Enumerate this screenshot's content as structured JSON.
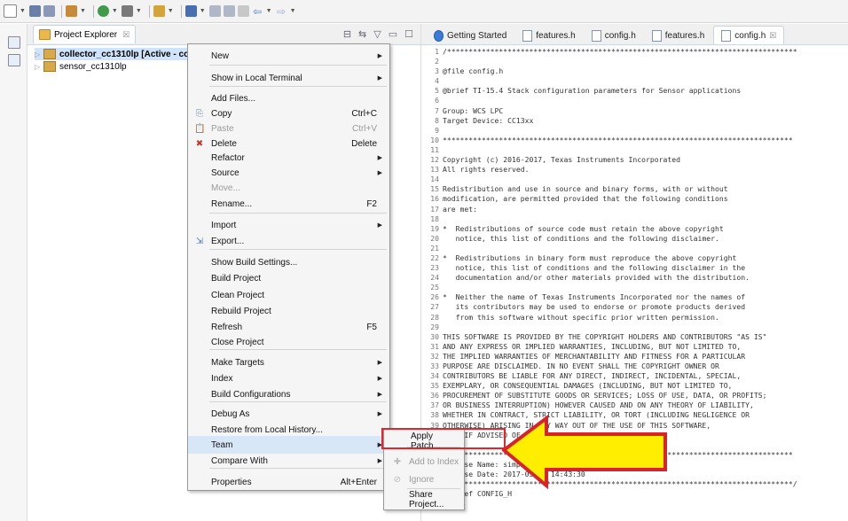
{
  "project_explorer": {
    "title": "Project Explorer",
    "tab_close": "☒",
    "projects": [
      {
        "name": "collector_cc1310lp [Active - col",
        "selected": true
      },
      {
        "name": "sensor_cc1310lp",
        "selected": false
      }
    ]
  },
  "context_menu": {
    "items": [
      {
        "label": "New",
        "shortcut": "",
        "submenu": true,
        "disabled": false
      },
      {
        "label": "Show in Local Terminal",
        "shortcut": "",
        "submenu": true,
        "disabled": false
      },
      {
        "label": "Add Files...",
        "shortcut": "",
        "submenu": false,
        "disabled": false
      },
      {
        "label": "Copy",
        "shortcut": "Ctrl+C",
        "submenu": false,
        "disabled": false
      },
      {
        "label": "Paste",
        "shortcut": "Ctrl+V",
        "submenu": false,
        "disabled": true
      },
      {
        "label": "Delete",
        "shortcut": "Delete",
        "submenu": false,
        "disabled": false
      },
      {
        "label": "Refactor",
        "shortcut": "",
        "submenu": true,
        "disabled": false
      },
      {
        "label": "Source",
        "shortcut": "",
        "submenu": true,
        "disabled": false
      },
      {
        "label": "Move...",
        "shortcut": "",
        "submenu": false,
        "disabled": true
      },
      {
        "label": "Rename...",
        "shortcut": "F2",
        "submenu": false,
        "disabled": false
      },
      {
        "label": "Import",
        "shortcut": "",
        "submenu": true,
        "disabled": false
      },
      {
        "label": "Export...",
        "shortcut": "",
        "submenu": false,
        "disabled": false
      },
      {
        "label": "Show Build Settings...",
        "shortcut": "",
        "submenu": false,
        "disabled": false
      },
      {
        "label": "Build Project",
        "shortcut": "",
        "submenu": false,
        "disabled": false
      },
      {
        "label": "Clean Project",
        "shortcut": "",
        "submenu": false,
        "disabled": false
      },
      {
        "label": "Rebuild Project",
        "shortcut": "",
        "submenu": false,
        "disabled": false
      },
      {
        "label": "Refresh",
        "shortcut": "F5",
        "submenu": false,
        "disabled": false
      },
      {
        "label": "Close Project",
        "shortcut": "",
        "submenu": false,
        "disabled": false
      },
      {
        "label": "Make Targets",
        "shortcut": "",
        "submenu": true,
        "disabled": false
      },
      {
        "label": "Index",
        "shortcut": "",
        "submenu": true,
        "disabled": false
      },
      {
        "label": "Build Configurations",
        "shortcut": "",
        "submenu": true,
        "disabled": false
      },
      {
        "label": "Debug As",
        "shortcut": "",
        "submenu": true,
        "disabled": false
      },
      {
        "label": "Restore from Local History...",
        "shortcut": "",
        "submenu": false,
        "disabled": false
      },
      {
        "label": "Team",
        "shortcut": "",
        "submenu": true,
        "disabled": false
      },
      {
        "label": "Compare With",
        "shortcut": "",
        "submenu": true,
        "disabled": false
      },
      {
        "label": "Properties",
        "shortcut": "Alt+Enter",
        "submenu": false,
        "disabled": false
      }
    ]
  },
  "team_submenu": {
    "items": [
      {
        "label": "Apply Patch...",
        "disabled": false
      },
      {
        "label": "Add to Index",
        "disabled": true
      },
      {
        "label": "Ignore",
        "disabled": true
      },
      {
        "label": "Share Project...",
        "disabled": false
      }
    ]
  },
  "editor": {
    "tabs": [
      {
        "label": "Getting Started",
        "active": false
      },
      {
        "label": "features.h",
        "active": false
      },
      {
        "label": "config.h",
        "active": false
      },
      {
        "label": "features.h",
        "active": false
      },
      {
        "label": "config.h",
        "active": true
      }
    ],
    "tab_close": "☒",
    "lines": [
      {
        "no": "1",
        "text": "/*********************************************************************************"
      },
      {
        "no": "2",
        "text": ""
      },
      {
        "no": "3",
        "text": "@file config.h"
      },
      {
        "no": "4",
        "text": ""
      },
      {
        "no": "5",
        "text": "@brief TI-15.4 Stack configuration parameters for Sensor applications"
      },
      {
        "no": "6",
        "text": ""
      },
      {
        "no": "7",
        "text": "Group: WCS LPC"
      },
      {
        "no": "8",
        "text": "Target Device: CC13xx"
      },
      {
        "no": "9",
        "text": ""
      },
      {
        "no": "10",
        "text": "*********************************************************************************"
      },
      {
        "no": "11",
        "text": ""
      },
      {
        "no": "12",
        "text": "Copyright (c) 2016-2017, Texas Instruments Incorporated"
      },
      {
        "no": "13",
        "text": "All rights reserved."
      },
      {
        "no": "14",
        "text": ""
      },
      {
        "no": "15",
        "text": "Redistribution and use in source and binary forms, with or without"
      },
      {
        "no": "16",
        "text": "modification, are permitted provided that the following conditions"
      },
      {
        "no": "17",
        "text": "are met:"
      },
      {
        "no": "18",
        "text": ""
      },
      {
        "no": "19",
        "text": "*  Redistributions of source code must retain the above copyright"
      },
      {
        "no": "20",
        "text": "   notice, this list of conditions and the following disclaimer."
      },
      {
        "no": "21",
        "text": ""
      },
      {
        "no": "22",
        "text": "*  Redistributions in binary form must reproduce the above copyright"
      },
      {
        "no": "23",
        "text": "   notice, this list of conditions and the following disclaimer in the"
      },
      {
        "no": "24",
        "text": "   documentation and/or other materials provided with the distribution."
      },
      {
        "no": "25",
        "text": ""
      },
      {
        "no": "26",
        "text": "*  Neither the name of Texas Instruments Incorporated nor the names of"
      },
      {
        "no": "27",
        "text": "   its contributors may be used to endorse or promote products derived"
      },
      {
        "no": "28",
        "text": "   from this software without specific prior written permission."
      },
      {
        "no": "29",
        "text": ""
      },
      {
        "no": "30",
        "text": "THIS SOFTWARE IS PROVIDED BY THE COPYRIGHT HOLDERS AND CONTRIBUTORS \"AS IS\""
      },
      {
        "no": "31",
        "text": "AND ANY EXPRESS OR IMPLIED WARRANTIES, INCLUDING, BUT NOT LIMITED TO,"
      },
      {
        "no": "32",
        "text": "THE IMPLIED WARRANTIES OF MERCHANTABILITY AND FITNESS FOR A PARTICULAR"
      },
      {
        "no": "33",
        "text": "PURPOSE ARE DISCLAIMED. IN NO EVENT SHALL THE COPYRIGHT OWNER OR"
      },
      {
        "no": "34",
        "text": "CONTRIBUTORS BE LIABLE FOR ANY DIRECT, INDIRECT, INCIDENTAL, SPECIAL,"
      },
      {
        "no": "35",
        "text": "EXEMPLARY, OR CONSEQUENTIAL DAMAGES (INCLUDING, BUT NOT LIMITED TO,"
      },
      {
        "no": "36",
        "text": "PROCUREMENT OF SUBSTITUTE GOODS OR SERVICES; LOSS OF USE, DATA, OR PROFITS;"
      },
      {
        "no": "37",
        "text": "OR BUSINESS INTERRUPTION) HOWEVER CAUSED AND ON ANY THEORY OF LIABILITY,"
      },
      {
        "no": "38",
        "text": "WHETHER IN CONTRACT, STRICT LIABILITY, OR TORT (INCLUDING NEGLIGENCE OR"
      },
      {
        "no": "39",
        "text": "OTHERWISE) ARISING IN ANY WAY OUT OF THE USE OF THIS SOFTWARE,"
      },
      {
        "no": "40",
        "text": "EVEN IF ADVISED OF THE POSSIBILITY OF SUCH DAMAGE."
      },
      {
        "no": "41",
        "text": ""
      },
      {
        "no": "42",
        "text": "*********************************************************************************"
      },
      {
        "no": "43",
        "text": "Release Name: simplelink_cc13x0_sdk_1_30_00_06\""
      },
      {
        "no": "44",
        "text": "Release Date: 2017-03-08 14:43:30"
      },
      {
        "no": "45",
        "text": "*********************************************************************************/"
      },
      {
        "no": "46",
        "text": "#ifndef CONFIG_H"
      }
    ]
  },
  "colors": {
    "highlight_box": "#e3242b",
    "arrow_fill": "#ffee00",
    "arrow_stroke": "#d8232a",
    "menu_highlight": "#d8e7f8",
    "selection": "#cfe4fb"
  }
}
